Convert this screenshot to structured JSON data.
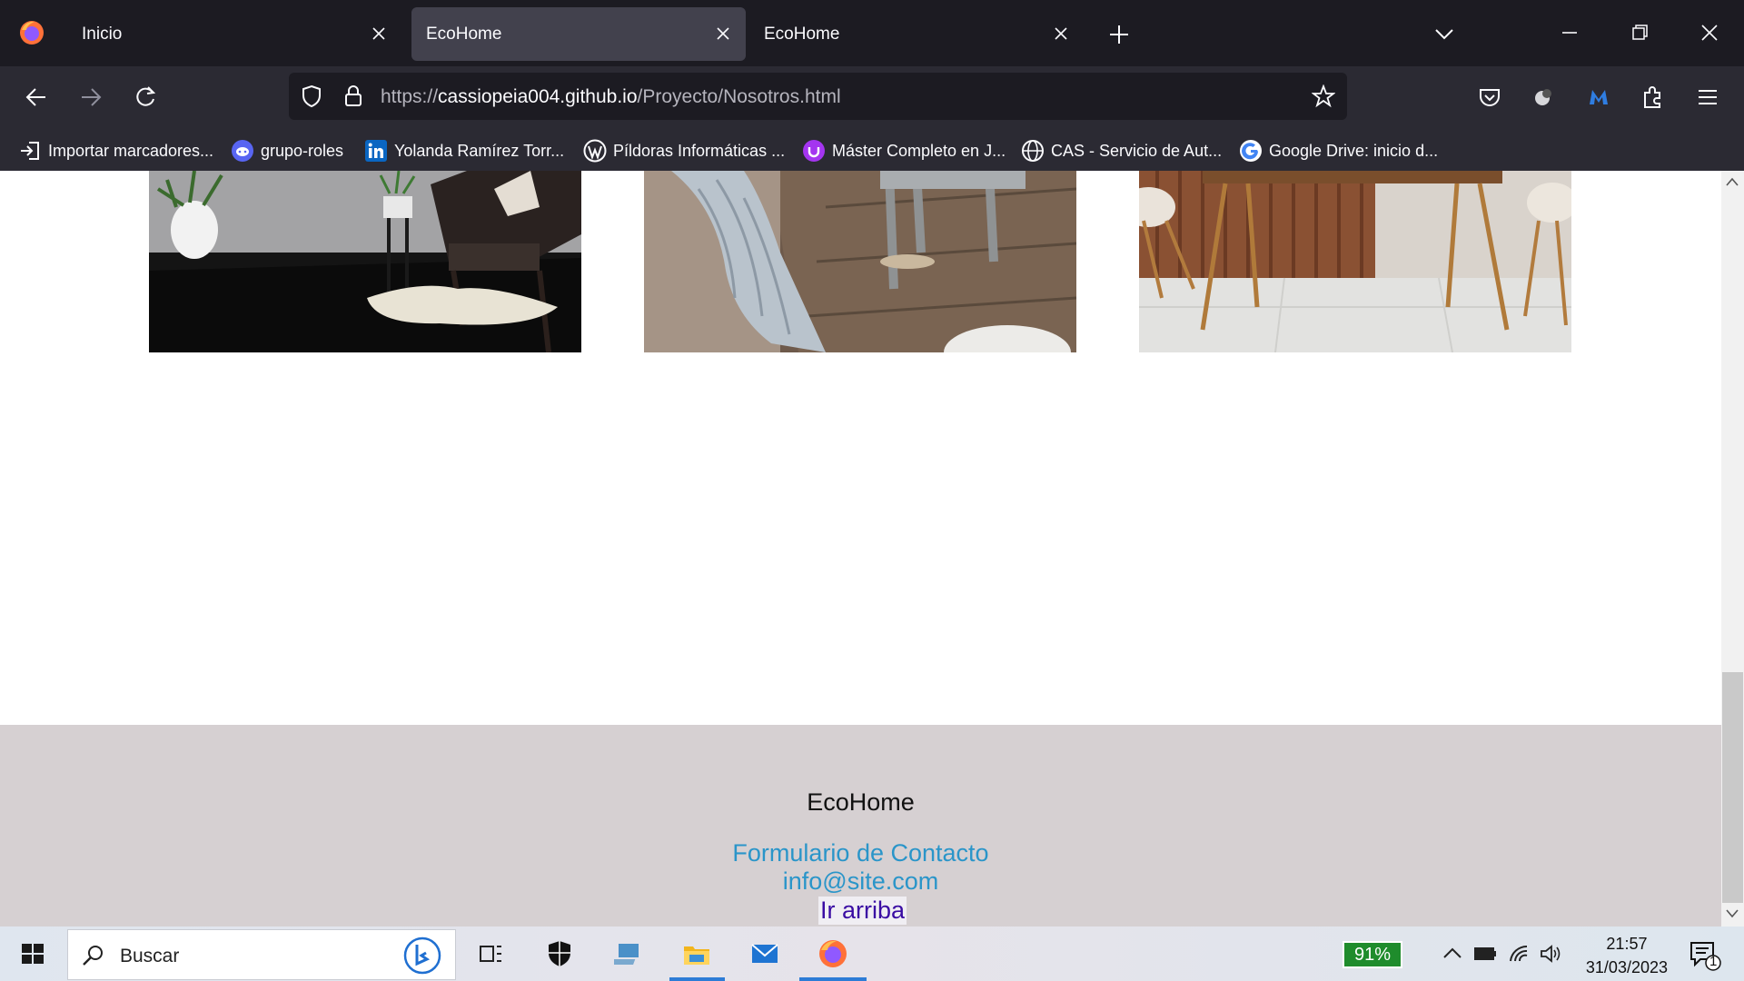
{
  "browser": {
    "tabs": [
      {
        "label": "Inicio",
        "active": false
      },
      {
        "label": "EcoHome",
        "active": true
      },
      {
        "label": "EcoHome",
        "active": false
      }
    ],
    "url": {
      "scheme": "https://",
      "host": "cassiopeia004.github.io",
      "path": "/Proyecto/Nosotros.html"
    },
    "bookmarks": [
      {
        "label": "Importar marcadores...",
        "icon": "import-icon"
      },
      {
        "label": "grupo-roles",
        "icon": "discord-icon"
      },
      {
        "label": "Yolanda Ramírez Torr...",
        "icon": "linkedin-icon"
      },
      {
        "label": "Píldoras Informáticas ...",
        "icon": "wordpress-icon"
      },
      {
        "label": "Máster Completo en J...",
        "icon": "udemy-icon"
      },
      {
        "label": "CAS - Servicio de Aut...",
        "icon": "globe-icon"
      },
      {
        "label": "Google Drive: inicio d...",
        "icon": "google-icon"
      }
    ]
  },
  "page": {
    "gallery": [
      {
        "name": "living-room-photo",
        "alt": "dark floor living room with armchair and plants"
      },
      {
        "name": "sofa-blanket-photo",
        "alt": "sofa with blanket and wooden floor"
      },
      {
        "name": "dining-table-photo",
        "alt": "wooden dining table with chairs"
      }
    ],
    "footer": {
      "brand": "EcoHome",
      "contact_link": "Formulario de Contacto",
      "email_link": "info@site.com",
      "top_link": "Ir arriba"
    }
  },
  "taskbar": {
    "search_placeholder": "Buscar",
    "battery": "91%",
    "time": "21:57",
    "date": "31/03/2023",
    "notifications": "1"
  },
  "colors": {
    "accent_link": "#2a95c9",
    "visited_link": "#3a0ca3",
    "footer_bg": "#d6d0d2",
    "battery_green": "#1f8c2c"
  }
}
